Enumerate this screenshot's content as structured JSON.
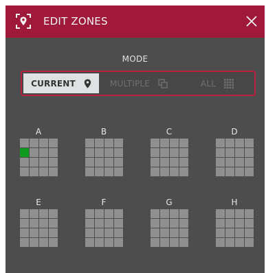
{
  "header": {
    "title": "EDIT ZONES",
    "icon": "location-pin-icon",
    "close_icon": "close-icon"
  },
  "mode": {
    "label": "MODE",
    "options": [
      {
        "label": "CURRENT",
        "icon": "location-pin-icon",
        "selected": true
      },
      {
        "label": "MULTIPLE",
        "icon": "copy-icon",
        "selected": false
      },
      {
        "label": "ALL",
        "icon": "grid-icon",
        "selected": false
      }
    ]
  },
  "zones": [
    {
      "label": "A",
      "active_cell": [
        1,
        0
      ]
    },
    {
      "label": "B"
    },
    {
      "label": "C"
    },
    {
      "label": "D"
    },
    {
      "label": "E"
    },
    {
      "label": "F"
    },
    {
      "label": "G"
    },
    {
      "label": "H"
    }
  ],
  "colors": {
    "header": "#a0193a",
    "background": "#4d4d4d",
    "accent_border": "#b8213f",
    "pad_off": "#8f8f8f",
    "pad_on": "#0e9a20"
  }
}
